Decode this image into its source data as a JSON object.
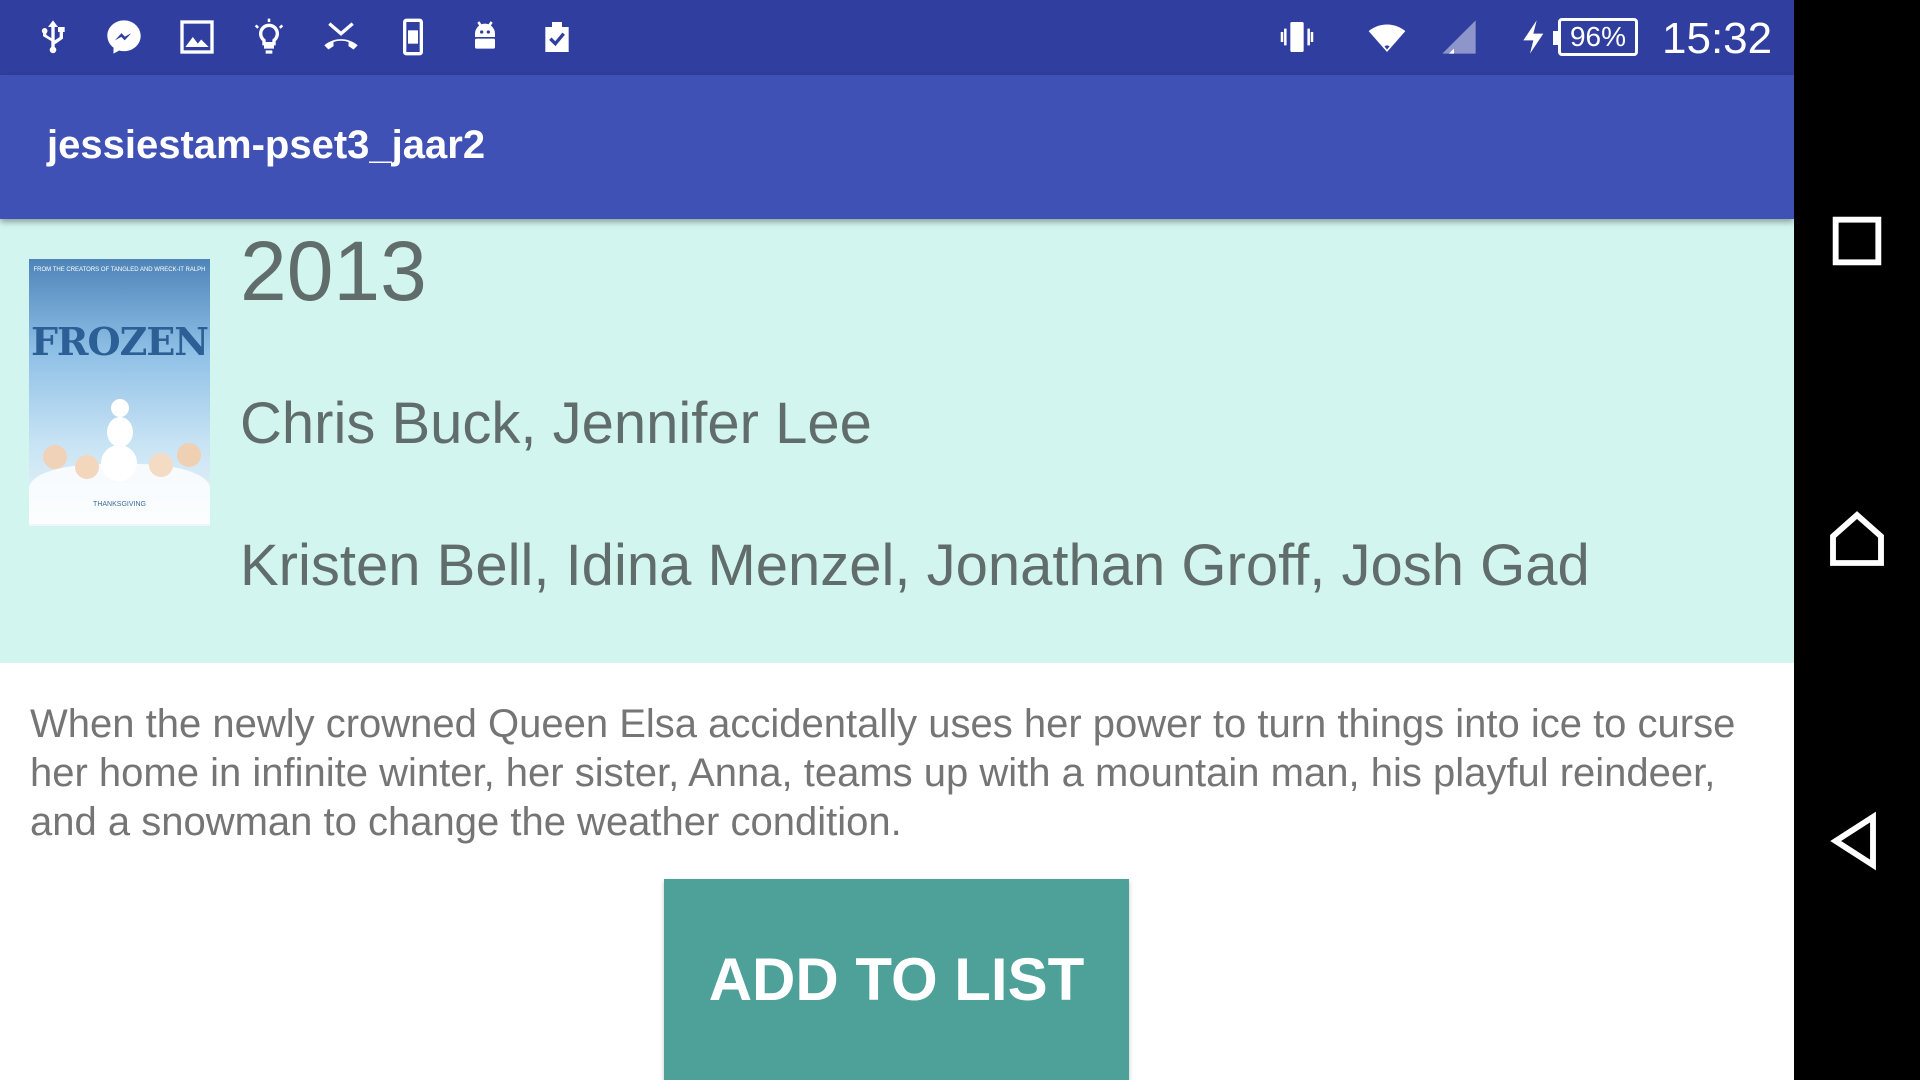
{
  "status_bar": {
    "left_icons": [
      "usb-icon",
      "messenger-icon",
      "image-icon",
      "lightbulb-icon",
      "missed-call-icon",
      "device-icon",
      "android-icon",
      "clipboard-check-icon"
    ],
    "battery_percent": "96%",
    "time": "15:32"
  },
  "app_bar": {
    "title": "jessiestam-pset3_jaar2"
  },
  "movie": {
    "poster_title": "FROZEN",
    "poster_top_text": "FROM THE CREATORS OF TANGLED AND WRECK-IT RALPH",
    "poster_bottom_text": "THANKSGIVING",
    "year": "2013",
    "directors": "Chris Buck, Jennifer Lee",
    "actors": "Kristen Bell, Idina Menzel, Jonathan Groff, Josh Gad",
    "plot": "When the newly crowned Queen Elsa accidentally uses her power to turn things into ice to curse her home in infinite winter, her sister, Anna, teams up with a mountain man, his playful reindeer, and a snowman to change the weather condition."
  },
  "actions": {
    "add_to_list_label": "ADD TO LIST"
  },
  "colors": {
    "status_bar": "#303f9f",
    "app_bar": "#3f51b5",
    "header_background": "#d3f5f0",
    "button": "#4da198"
  }
}
